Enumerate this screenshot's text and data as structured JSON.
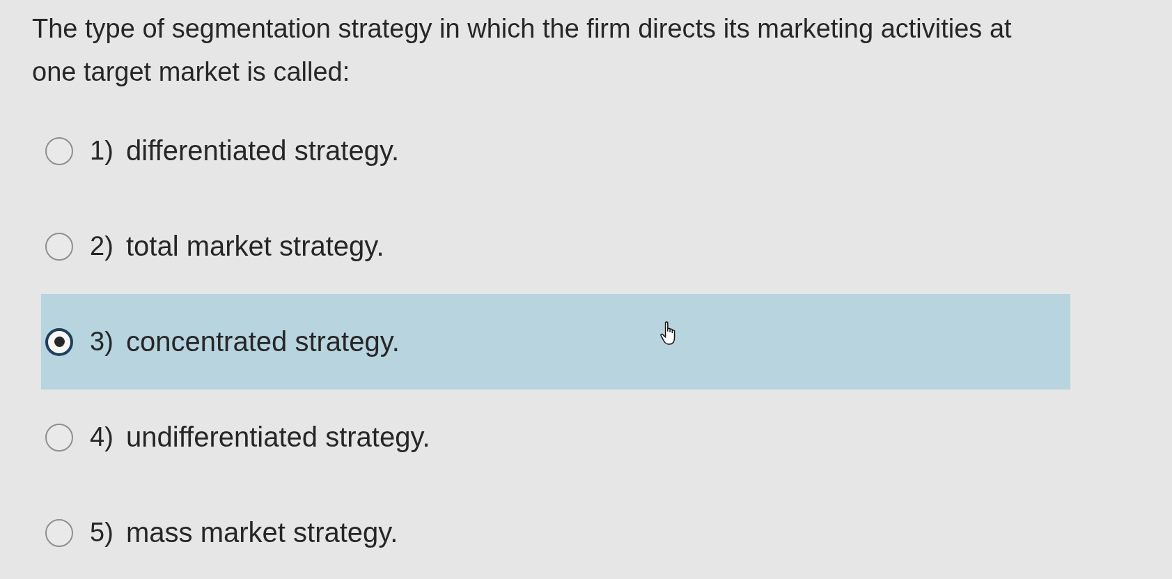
{
  "question": "The type of segmentation strategy in which the firm directs its marketing activities at one target market is called:",
  "options": [
    {
      "number": "1)",
      "text": "differentiated strategy.",
      "selected": false
    },
    {
      "number": "2)",
      "text": "total market strategy.",
      "selected": false
    },
    {
      "number": "3)",
      "text": "concentrated strategy.",
      "selected": true
    },
    {
      "number": "4)",
      "text": "undifferentiated strategy.",
      "selected": false
    },
    {
      "number": "5)",
      "text": "mass market strategy.",
      "selected": false
    }
  ]
}
